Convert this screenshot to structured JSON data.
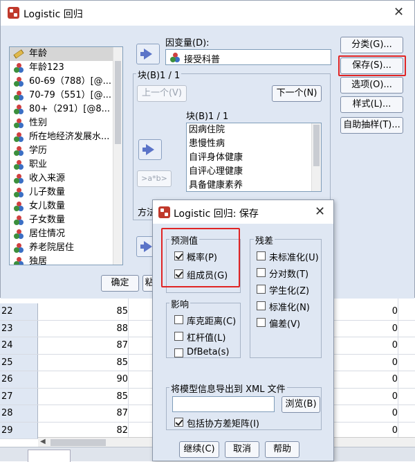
{
  "main_dialog": {
    "title": "Logistic 回归",
    "variables": [
      "年龄",
      "年龄123",
      "60-69（788）[@...",
      "70-79（551）[@...",
      "80+（291）[@8...",
      "性别",
      "所在地经济发展水...",
      "学历",
      "职业",
      "收入来源",
      "儿子数量",
      "女儿数量",
      "子女数量",
      "居住情况",
      "养老院居住",
      "独居"
    ],
    "dependent_label": "因变量(D):",
    "dependent_value": "接受科普",
    "block_group_label": "块(B)1 / 1",
    "prev_button": "上一个(V)",
    "next_button": "下一个(N)",
    "block_list_label": "块(B)1 / 1",
    "block_items": [
      "因病住院",
      "患慢性病",
      "自评身体健康",
      "自评心理健康",
      "具备健康素养"
    ],
    "interaction_button": ">a*b>",
    "method_label": "方法",
    "ok_button": "确定",
    "partial_button": "粘",
    "side_buttons": [
      "分类(G)...",
      "保存(S)...",
      "选项(O)...",
      "样式(L)...",
      "自助抽样(T)..."
    ]
  },
  "grid": {
    "rows": [
      {
        "id": "22",
        "a": "85",
        "b": "0"
      },
      {
        "id": "23",
        "a": "88",
        "b": "0"
      },
      {
        "id": "24",
        "a": "87",
        "b": "0"
      },
      {
        "id": "25",
        "a": "85",
        "b": "0"
      },
      {
        "id": "26",
        "a": "90",
        "b": "0"
      },
      {
        "id": "27",
        "a": "85",
        "b": "0"
      },
      {
        "id": "28",
        "a": "87",
        "b": "0"
      },
      {
        "id": "29",
        "a": "82",
        "b": "0"
      }
    ]
  },
  "save_dialog": {
    "title": "Logistic 回归: 保存",
    "predicted_group": "预测值",
    "predicted_options": [
      {
        "label": "概率(P)",
        "checked": true
      },
      {
        "label": "组成员(G)",
        "checked": true
      }
    ],
    "influence_group": "影响",
    "influence_options": [
      {
        "label": "库克距离(C)",
        "checked": false
      },
      {
        "label": "杠杆值(L)",
        "checked": false
      },
      {
        "label": "DfBeta(s)",
        "checked": false
      }
    ],
    "residual_group": "残差",
    "residual_options": [
      {
        "label": "未标准化(U)",
        "checked": false
      },
      {
        "label": "分对数(T)",
        "checked": false
      },
      {
        "label": "学生化(Z)",
        "checked": false
      },
      {
        "label": "标准化(N)",
        "checked": false
      },
      {
        "label": "偏差(V)",
        "checked": false
      }
    ],
    "export_group": "将模型信息导出到 XML 文件",
    "export_path": "",
    "browse_button": "浏览(B)",
    "covariance_option": {
      "label": "包括协方差矩阵(I)",
      "checked": true
    },
    "continue_button": "继续(C)",
    "cancel_button": "取消",
    "help_button": "帮助"
  },
  "colors": {
    "highlight": "#e02424",
    "dialog_bg": "#dfe7f3",
    "accent": "#5b74c8"
  }
}
